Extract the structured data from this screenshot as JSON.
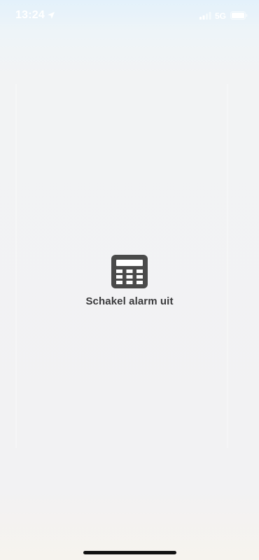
{
  "status_bar": {
    "time": "13:24",
    "network": "5G",
    "icons": [
      "location-arrow-icon",
      "signal-bars-icon",
      "battery-icon"
    ]
  },
  "main": {
    "action_icon": "keypad-icon",
    "action_label": "Schakel alarm uit"
  },
  "colors": {
    "icon": "#4a4a4a",
    "label": "#3a3a3c",
    "status_text": "#ffffff",
    "home_indicator": "#111111"
  }
}
